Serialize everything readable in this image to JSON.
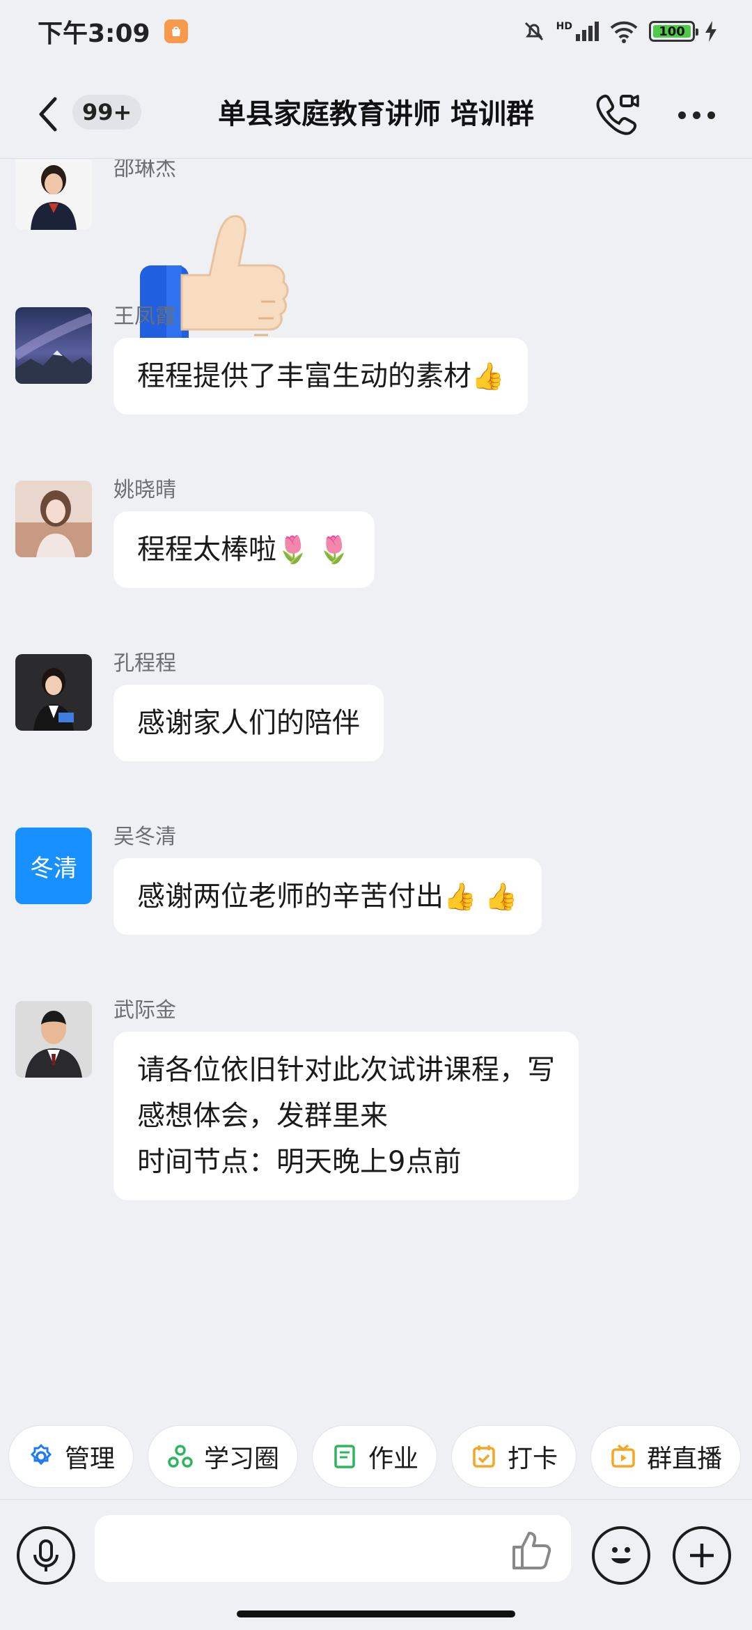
{
  "status_bar": {
    "time": "下午3:09",
    "signal_label": "HD",
    "battery_level": "100"
  },
  "header": {
    "unread_count": "99+",
    "title": "单县家庭教育讲师 培训群"
  },
  "messages": [
    {
      "sender": "邵琳杰",
      "type": "sticker",
      "sticker": "thumbs-up"
    },
    {
      "sender": "王凤霞",
      "text": "程程提供了丰富生动的素材",
      "emoji": "👍"
    },
    {
      "sender": "姚晓晴",
      "text": "程程太棒啦",
      "emoji": "🌷 🌷"
    },
    {
      "sender": "孔程程",
      "text": "感谢家人们的陪伴"
    },
    {
      "sender": "吴冬清",
      "avatar_text": "冬清",
      "text": "感谢两位老师的辛苦付出",
      "emoji": "👍 👍"
    },
    {
      "sender": "武际金",
      "lines": [
        "请各位依旧针对此次试讲课程，写",
        "感想体会，发群里来",
        "时间节点：明天晚上9点前"
      ]
    }
  ],
  "quick_tools": [
    {
      "label": "管理",
      "icon": "gear-icon",
      "color": "#1f7cf0"
    },
    {
      "label": "学习圈",
      "icon": "circles-icon",
      "color": "#2db55d"
    },
    {
      "label": "作业",
      "icon": "book-icon",
      "color": "#2db55d"
    },
    {
      "label": "打卡",
      "icon": "calendar-check-icon",
      "color": "#f5a623"
    },
    {
      "label": "群直播",
      "icon": "tv-icon",
      "color": "#f5a623"
    }
  ],
  "input": {
    "placeholder": ""
  }
}
